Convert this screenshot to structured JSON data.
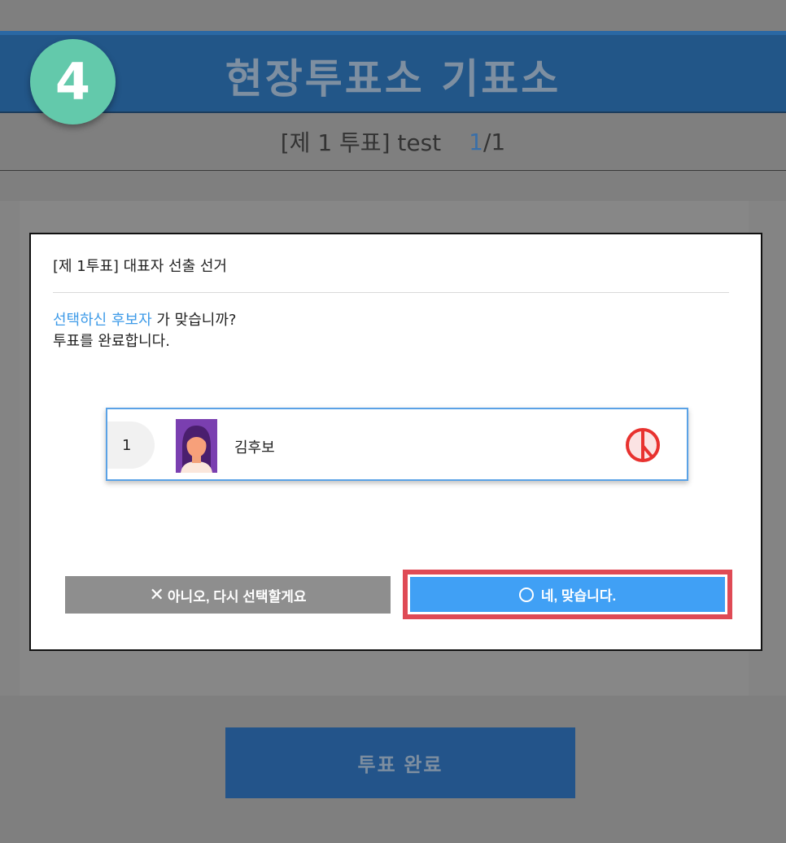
{
  "header": {
    "title": "현장투표소 기표소",
    "step_number": "4"
  },
  "ballot_info": {
    "label": "[제 1 투표] test",
    "current_page": "1",
    "total_pages": "/1"
  },
  "footer": {
    "complete_label": "투표 완료"
  },
  "modal": {
    "title": "[제 1투표] 대표자 선출 선거",
    "question_highlight": "선택하신 후보자",
    "question_rest": " 가 맞습니까?",
    "question_line2": "투표를 완료합니다.",
    "candidate": {
      "number": "1",
      "name": "김후보"
    },
    "no_label": "아니오, 다시 선택할게요",
    "yes_label": "네, 맞습니다."
  },
  "colors": {
    "accent_blue": "#40a0f5",
    "highlight_border": "#df4a55",
    "header_blue": "#225688",
    "badge_green": "#63c9ab"
  },
  "icons": {
    "no_icon": "close-icon",
    "yes_icon": "circle-icon",
    "vote_mark": "vote-stamp-icon"
  }
}
